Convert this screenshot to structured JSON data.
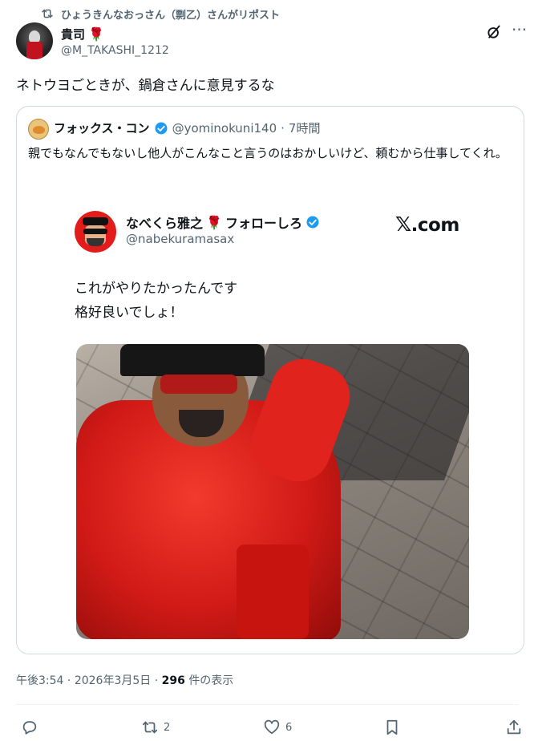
{
  "repost": {
    "text": "ひょうきんなおっさん（剽乙）さんがリポスト"
  },
  "author": {
    "name": "貴司",
    "emoji": "🌹",
    "handle": "@M_TAKASHI_1212"
  },
  "tweet": {
    "text": "ネトウヨごときが、鍋倉さんに意見するな"
  },
  "quote": {
    "name": "フォックス・コン",
    "handle": "@yominokuni140",
    "separator": "·",
    "time": "7時間",
    "text": "親でもなんでもないし他人がこんなこと言うのはおかしいけど、頼むから仕事してくれ。",
    "screenshot": {
      "name": "なべくら雅之",
      "name_suffix": "フォローしろ",
      "emoji": "🌹",
      "handle": "@nabekuramasax",
      "brand_mark": "𝕏",
      "brand_text": ".com",
      "line1": "これがやりたかったんです",
      "line2": "格好良いでしょ！"
    }
  },
  "footer": {
    "time": "午後3:54",
    "sep1": "·",
    "date": "2026年3月5日",
    "sep2": "·",
    "views_count": "296",
    "views_label": "件の表示"
  },
  "actions": {
    "replies": "",
    "reposts": "2",
    "likes": "6"
  },
  "colors": {
    "verified": "#1d9bf0",
    "secondary_text": "#536471",
    "border": "#cfd9de"
  }
}
